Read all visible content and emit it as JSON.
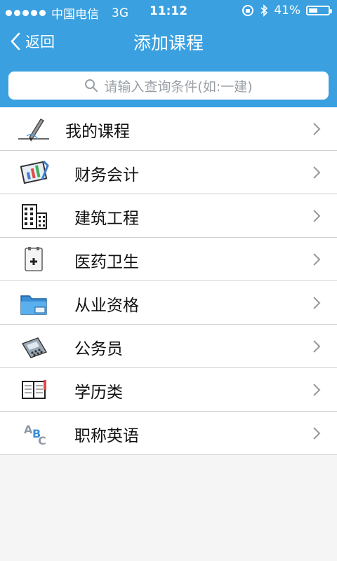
{
  "status_bar": {
    "carrier": "中国电信",
    "network": "3G",
    "time": "11:12",
    "battery": "41%"
  },
  "header": {
    "back_label": "返回",
    "title": "添加课程"
  },
  "search": {
    "placeholder": "请输入查询条件(如:一建)"
  },
  "list": {
    "items": [
      {
        "label": "我的课程",
        "icon": "pen-edit-icon"
      },
      {
        "label": "财务会计",
        "icon": "finance-chart-icon"
      },
      {
        "label": "建筑工程",
        "icon": "buildings-icon"
      },
      {
        "label": "医药卫生",
        "icon": "medical-kit-icon"
      },
      {
        "label": "从业资格",
        "icon": "folder-icon"
      },
      {
        "label": "公务员",
        "icon": "calculator-icon"
      },
      {
        "label": "学历类",
        "icon": "notebook-icon"
      },
      {
        "label": "职称英语",
        "icon": "abc-letters-icon"
      }
    ]
  },
  "colors": {
    "header_bg": "#3aa0e0",
    "list_bg": "#ffffff",
    "divider": "#cfcfcf"
  }
}
